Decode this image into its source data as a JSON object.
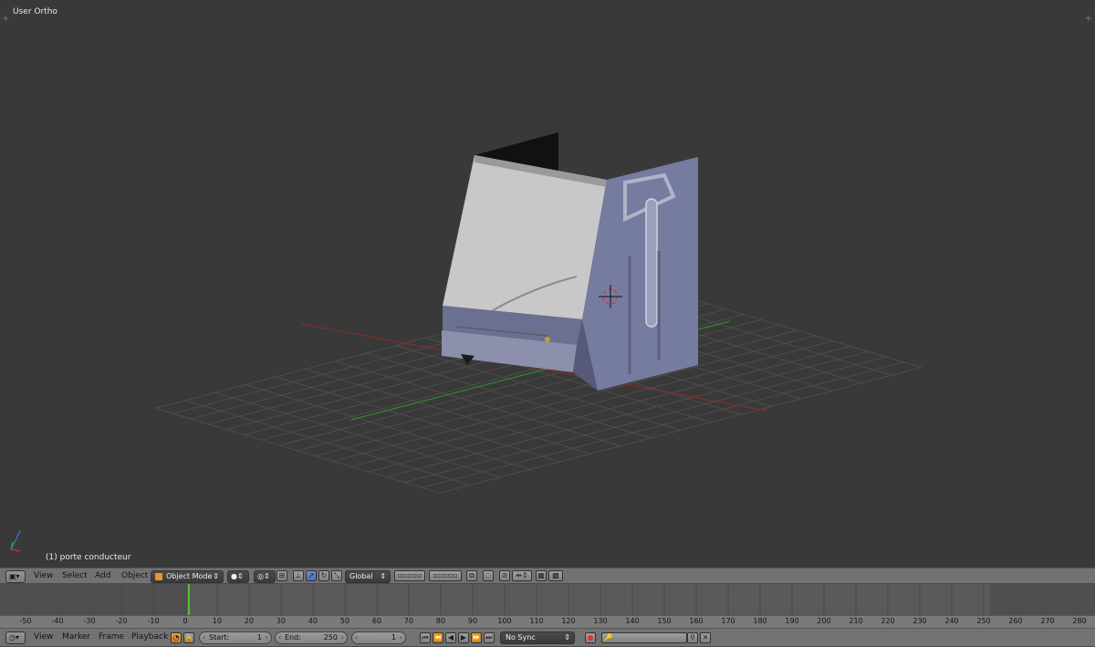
{
  "viewport": {
    "view_name": "User Ortho",
    "active_object": "(1) porte conducteur"
  },
  "header_3d": {
    "menus": [
      "View",
      "Select",
      "Add",
      "Object"
    ],
    "mode": "Object Mode",
    "orientation": "Global"
  },
  "timeline": {
    "ticks": [
      "-50",
      "-40",
      "-30",
      "-20",
      "-10",
      "0",
      "10",
      "20",
      "30",
      "40",
      "50",
      "60",
      "70",
      "80",
      "90",
      "100",
      "110",
      "120",
      "130",
      "140",
      "150",
      "160",
      "170",
      "180",
      "190",
      "200",
      "210",
      "220",
      "230",
      "240",
      "250",
      "260",
      "270",
      "280"
    ],
    "current_frame": "0"
  },
  "header_tl": {
    "menus": [
      "View",
      "Marker",
      "Frame",
      "Playback"
    ],
    "start_label": "Start:",
    "start_value": "1",
    "end_label": "End:",
    "end_value": "250",
    "frame_value": "1",
    "sync": "No Sync"
  },
  "colors": {
    "viewport_bg": "#393939",
    "header_bg": "#727272",
    "x_axis": "#8a2a2a",
    "y_axis": "#2d8a2d",
    "model": "#7c80a0"
  }
}
